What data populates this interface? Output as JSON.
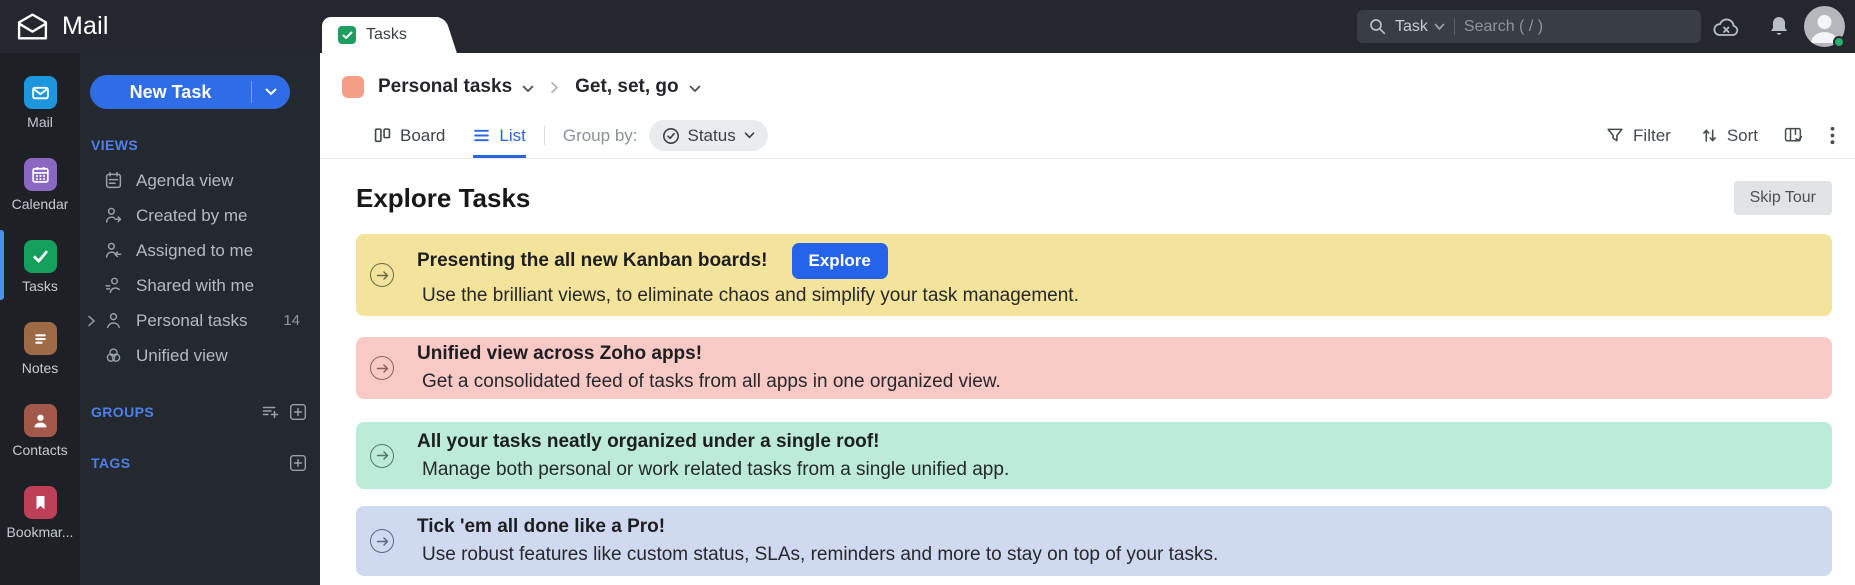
{
  "colors": {
    "accent_blue": "#2e6de5",
    "topbar_bg": "#24272d",
    "active_indicator": "#4d8ef0",
    "breadcrumb_swatch": "#f59e86"
  },
  "topbar": {
    "app_name": "Mail",
    "tab_label": "Tasks",
    "search_scope": "Task",
    "search_placeholder": "Search ( / )"
  },
  "rail": {
    "items": [
      {
        "label": "Mail",
        "icon": "mail-icon",
        "color": "#1d96dd",
        "active": false
      },
      {
        "label": "Calendar",
        "icon": "calendar-icon",
        "color": "#8a68c2",
        "active": false
      },
      {
        "label": "Tasks",
        "icon": "tasks-icon",
        "color": "#149f5c",
        "active": true
      },
      {
        "label": "Notes",
        "icon": "notes-icon",
        "color": "#9c6a45",
        "active": false
      },
      {
        "label": "Contacts",
        "icon": "contacts-icon",
        "color": "#a2594a",
        "active": false
      },
      {
        "label": "Bookmar...",
        "icon": "bookmarks-icon",
        "color": "#bc4057",
        "active": false
      }
    ]
  },
  "sidebar": {
    "new_task_label": "New Task",
    "views_label": "VIEWS",
    "views": [
      {
        "label": "Agenda view"
      },
      {
        "label": "Created by me"
      },
      {
        "label": "Assigned to me"
      },
      {
        "label": "Shared with me"
      },
      {
        "label": "Personal tasks",
        "count": "14"
      },
      {
        "label": "Unified view"
      }
    ],
    "groups_label": "GROUPS",
    "tags_label": "TAGS"
  },
  "breadcrumb": {
    "list_name": "Personal tasks",
    "view_name": "Get, set, go"
  },
  "toolbar": {
    "board_label": "Board",
    "list_label": "List",
    "group_by_label": "Group by:",
    "group_by_value": "Status",
    "filter_label": "Filter",
    "sort_label": "Sort"
  },
  "main": {
    "heading": "Explore Tasks",
    "skip_tour_label": "Skip Tour",
    "cards": [
      {
        "title": "Presenting the all new Kanban boards!",
        "button_label": "Explore",
        "subtitle": "Use the brilliant views, to eliminate chaos and simplify your task management.",
        "bg": "#f4e49b",
        "accent": "#6e6a45"
      },
      {
        "title": "Unified view across Zoho apps!",
        "subtitle": "Get a consolidated feed of tasks from all apps in one organized view.",
        "bg": "#f9c9c6",
        "accent": "#8a6260"
      },
      {
        "title": "All your tasks neatly organized under a single roof!",
        "subtitle": "Manage both personal or work related tasks from a single unified app.",
        "bg": "#bcecd9",
        "accent": "#56776c"
      },
      {
        "title": "Tick 'em all done like a Pro!",
        "subtitle": "Use robust features like custom status, SLAs, reminders and more to stay on top of your tasks.",
        "bg": "#cfd9ef",
        "accent": "#5d6880"
      }
    ]
  }
}
